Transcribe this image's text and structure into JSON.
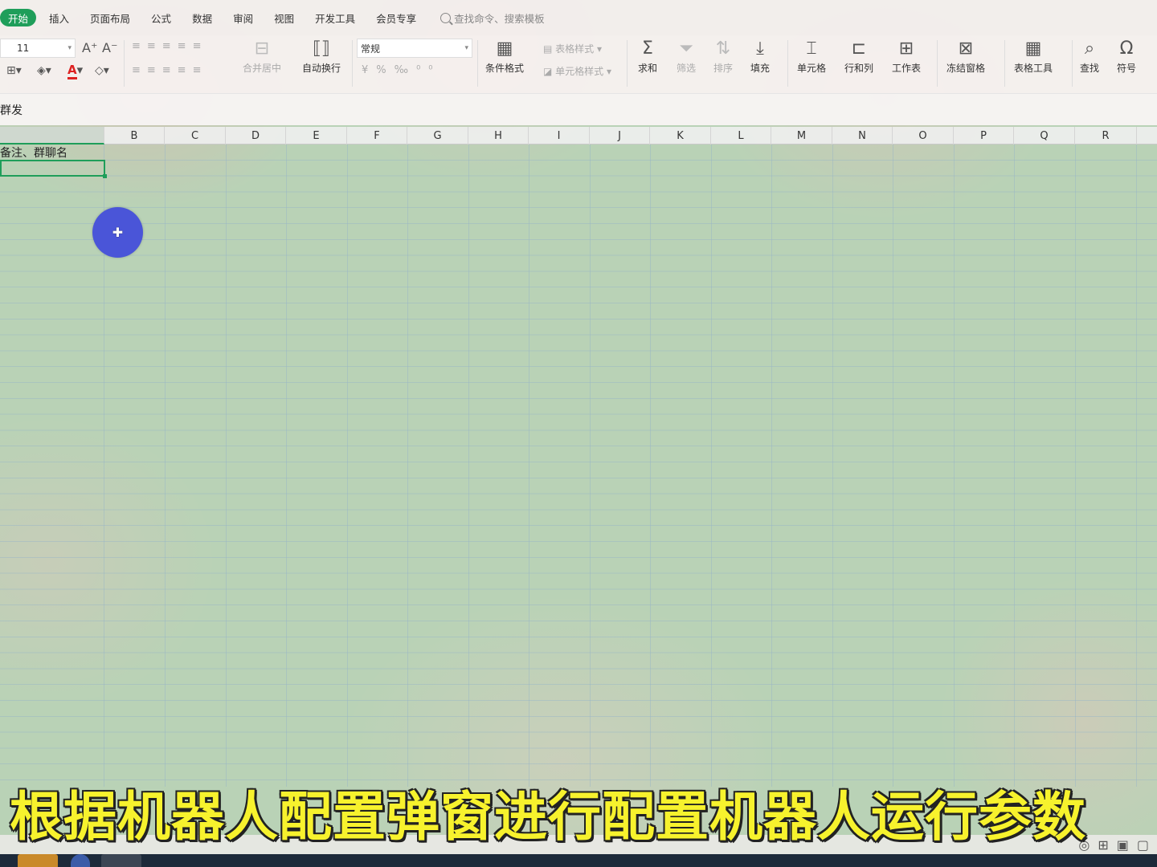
{
  "menu": {
    "tabs": [
      "开始",
      "插入",
      "页面布局",
      "公式",
      "数据",
      "审阅",
      "视图",
      "开发工具",
      "会员专享"
    ],
    "search_placeholder": "查找命令、搜索模板"
  },
  "ribbon": {
    "font_size": "11",
    "merge_center": "合并居中",
    "wrap_text": "自动换行",
    "number_format": "常规",
    "conditional_format": "条件格式",
    "table_style": "表格样式",
    "cell_style": "单元格样式",
    "sum": "求和",
    "filter": "筛选",
    "sort": "排序",
    "fill": "填充",
    "cell": "单元格",
    "row_col": "行和列",
    "worksheet": "工作表",
    "freeze": "冻结窗格",
    "table_tools": "表格工具",
    "find": "查找",
    "symbol": "符号"
  },
  "formula_bar": {
    "content": "群发"
  },
  "columns": [
    "B",
    "C",
    "D",
    "E",
    "F",
    "G",
    "H",
    "I",
    "J",
    "K",
    "L",
    "M",
    "N",
    "O",
    "P",
    "Q",
    "R"
  ],
  "cells": {
    "a1": "备注、群聊名"
  },
  "subtitle": "根据机器人配置弹窗进行配置机器人运行参数",
  "colors": {
    "accent": "#1f9e5a",
    "cursor": "#4a55d8",
    "subtitle": "#f7f22d"
  }
}
